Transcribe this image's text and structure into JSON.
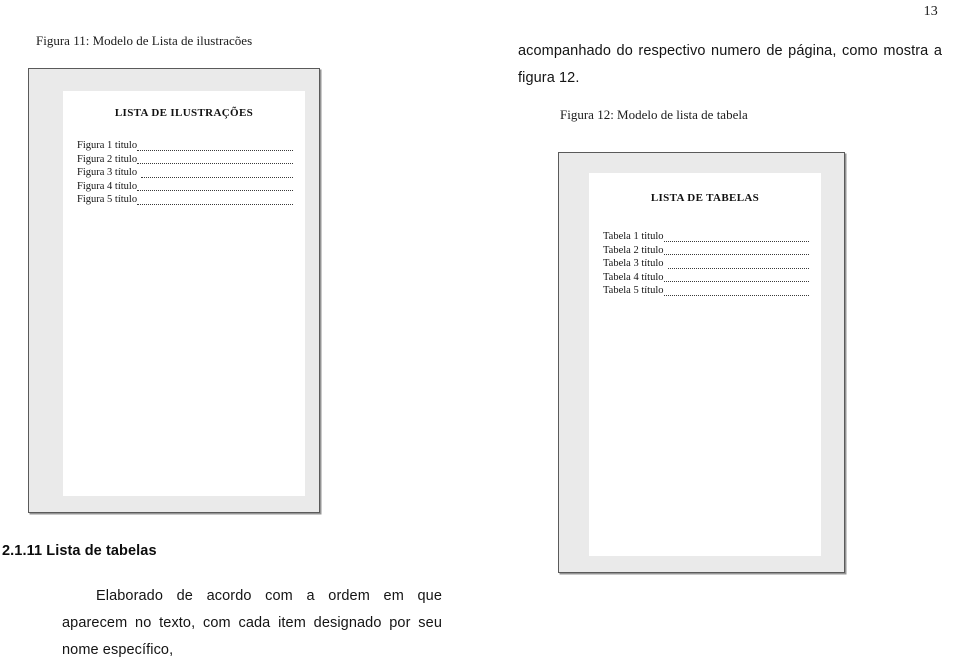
{
  "page": {
    "number": "13"
  },
  "paragraphs": {
    "top": "acompanhado do respectivo numero de página, como mostra a figura 12.",
    "bottom_lead": "Elaborado de acordo com a ordem em que aparecem no texto, com cada item designado por seu nome específico,"
  },
  "section": {
    "heading": "2.1.11 Lista de tabelas"
  },
  "figures": [
    {
      "caption": "Figura 11: Modelo de Lista de ilustracões",
      "inner_title": "LISTA DE ILUSTRAÇÕES",
      "entries": [
        "Figura 1 titulo",
        "Figura 2 titulo",
        "Figura 3 título",
        "Figura 4 título",
        "Figura 5 título"
      ]
    },
    {
      "caption": "Figura 12: Modelo de lista de tabela",
      "inner_title": "LISTA DE TABELAS",
      "entries": [
        "Tabela 1 titulo",
        "Tabela 2 titulo",
        "Tabela 3 título",
        "Tabela 4 título",
        "Tabela 5 título"
      ]
    }
  ]
}
